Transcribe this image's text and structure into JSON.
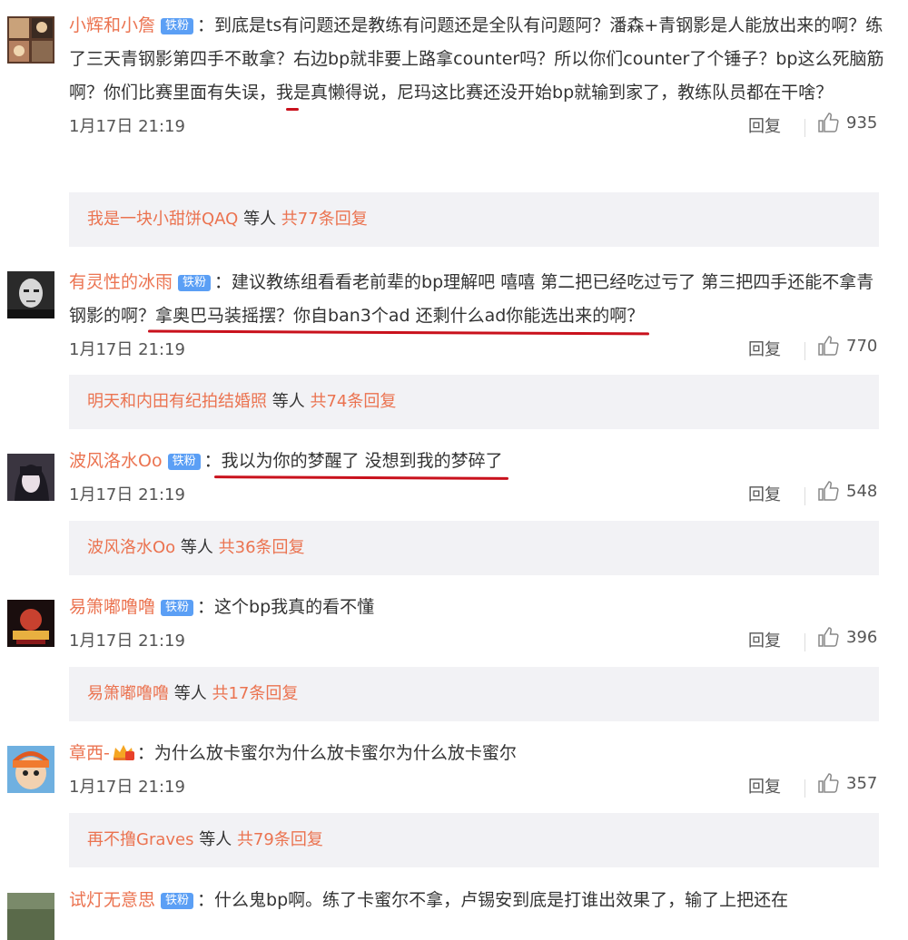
{
  "badge_label": "铁粉",
  "reply_label": "回复",
  "comments": [
    {
      "username": "小辉和小詹",
      "text_parts": [
        "：到底是ts有问题还是教练有问题还是全队有问题阿？潘森+青钢影是人能放出来的啊？练了三天青钢影第四手不敢拿？",
        "右边bp就非要上路拿counter吗？所以你们counter了个锤子？bp这么死脑筋啊？",
        "你们比赛里面有失误，我是真懒得说，尼玛这比赛还没开始bp就输到家了，教练队员都在干啥？"
      ],
      "time": "1月17日 21:19",
      "likes": "935",
      "more": {
        "who": "我是一块小甜饼QAQ",
        "mid": " 等人 ",
        "count": "共77条回复"
      }
    },
    {
      "username": "有灵性的冰雨",
      "text_parts": [
        "：建议教练组看看老前辈的bp理解吧 嘻嘻 第二把已经吃过亏了 第三把四手还能不拿青钢影的啊？",
        "拿奥巴马装摇摆？你自ban3个ad 还剩什么ad你能选出来的啊？",
        ""
      ],
      "time": "1月17日 21:19",
      "likes": "770",
      "more": {
        "who": "明天和内田有纪拍结婚照",
        "mid": " 等人 ",
        "count": "共74条回复"
      }
    },
    {
      "username": "波风洛水Oo",
      "text_parts": [
        "：",
        "我以为你的梦醒了 没想到我的梦碎了",
        ""
      ],
      "time": "1月17日 21:19",
      "likes": "548",
      "more": {
        "who": "波风洛水Oo",
        "mid": " 等人 ",
        "count": "共36条回复"
      }
    },
    {
      "username": "易箫嘟噜噜",
      "text_parts": [
        "：这个bp我真的看不懂",
        "",
        ""
      ],
      "time": "1月17日 21:19",
      "likes": "396",
      "more": {
        "who": "易箫嘟噜噜",
        "mid": " 等人 ",
        "count": "共17条回复"
      }
    },
    {
      "username": "章西-",
      "text_parts": [
        "：为什么放卡蜜尔为什么放卡蜜尔为什么放卡蜜尔",
        "",
        ""
      ],
      "time": "1月17日 21:19",
      "likes": "357",
      "more": {
        "who": "再不撸Graves",
        "mid": " 等人 ",
        "count": "共79条回复"
      }
    },
    {
      "username": "试灯无意思",
      "text_parts": [
        "：什么鬼bp啊。练了卡蜜尔不拿，卢锡安到底是打谁出效果了，输了上把还在",
        "",
        ""
      ],
      "time": "",
      "likes": "",
      "more": null
    }
  ],
  "colors": {
    "username": "#eb7350",
    "badge": "#5b9ff5",
    "underline": "#c9111c",
    "more_bg": "#f2f2f5"
  }
}
